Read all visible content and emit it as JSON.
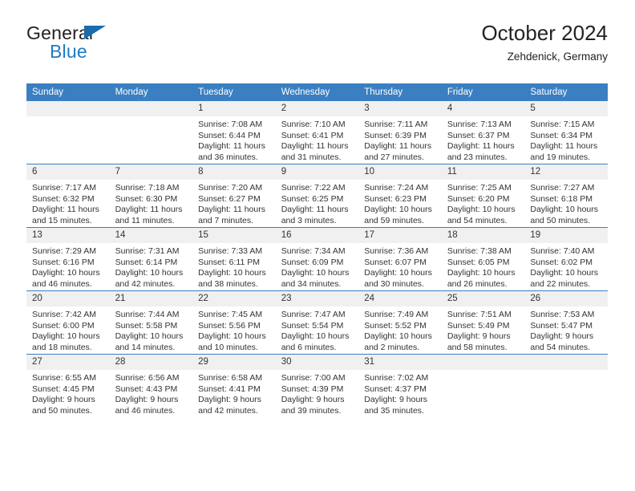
{
  "brand": {
    "name_top": "General",
    "name_bottom": "Blue",
    "triangle_color": "#1b6ca8",
    "blue_text_color": "#1f7ac0"
  },
  "header": {
    "title": "October 2024",
    "subtitle": "Zehdenick, Germany"
  },
  "theme": {
    "header_blue": "#3a7fc1",
    "daynum_band": "#f0f0f0",
    "text": "#333333"
  },
  "labels": {
    "sunrise_prefix": "Sunrise:",
    "sunset_prefix": "Sunset:",
    "daylight_prefix": "Daylight:"
  },
  "columns": [
    "Sunday",
    "Monday",
    "Tuesday",
    "Wednesday",
    "Thursday",
    "Friday",
    "Saturday"
  ],
  "weeks": [
    [
      {
        "day": "",
        "blank": true
      },
      {
        "day": "",
        "blank": true
      },
      {
        "day": "1",
        "sunrise": "Sunrise: 7:08 AM",
        "sunset": "Sunset: 6:44 PM",
        "daylight": "Daylight: 11 hours and 36 minutes."
      },
      {
        "day": "2",
        "sunrise": "Sunrise: 7:10 AM",
        "sunset": "Sunset: 6:41 PM",
        "daylight": "Daylight: 11 hours and 31 minutes."
      },
      {
        "day": "3",
        "sunrise": "Sunrise: 7:11 AM",
        "sunset": "Sunset: 6:39 PM",
        "daylight": "Daylight: 11 hours and 27 minutes."
      },
      {
        "day": "4",
        "sunrise": "Sunrise: 7:13 AM",
        "sunset": "Sunset: 6:37 PM",
        "daylight": "Daylight: 11 hours and 23 minutes."
      },
      {
        "day": "5",
        "sunrise": "Sunrise: 7:15 AM",
        "sunset": "Sunset: 6:34 PM",
        "daylight": "Daylight: 11 hours and 19 minutes."
      }
    ],
    [
      {
        "day": "6",
        "sunrise": "Sunrise: 7:17 AM",
        "sunset": "Sunset: 6:32 PM",
        "daylight": "Daylight: 11 hours and 15 minutes."
      },
      {
        "day": "7",
        "sunrise": "Sunrise: 7:18 AM",
        "sunset": "Sunset: 6:30 PM",
        "daylight": "Daylight: 11 hours and 11 minutes."
      },
      {
        "day": "8",
        "sunrise": "Sunrise: 7:20 AM",
        "sunset": "Sunset: 6:27 PM",
        "daylight": "Daylight: 11 hours and 7 minutes."
      },
      {
        "day": "9",
        "sunrise": "Sunrise: 7:22 AM",
        "sunset": "Sunset: 6:25 PM",
        "daylight": "Daylight: 11 hours and 3 minutes."
      },
      {
        "day": "10",
        "sunrise": "Sunrise: 7:24 AM",
        "sunset": "Sunset: 6:23 PM",
        "daylight": "Daylight: 10 hours and 59 minutes."
      },
      {
        "day": "11",
        "sunrise": "Sunrise: 7:25 AM",
        "sunset": "Sunset: 6:20 PM",
        "daylight": "Daylight: 10 hours and 54 minutes."
      },
      {
        "day": "12",
        "sunrise": "Sunrise: 7:27 AM",
        "sunset": "Sunset: 6:18 PM",
        "daylight": "Daylight: 10 hours and 50 minutes."
      }
    ],
    [
      {
        "day": "13",
        "sunrise": "Sunrise: 7:29 AM",
        "sunset": "Sunset: 6:16 PM",
        "daylight": "Daylight: 10 hours and 46 minutes."
      },
      {
        "day": "14",
        "sunrise": "Sunrise: 7:31 AM",
        "sunset": "Sunset: 6:14 PM",
        "daylight": "Daylight: 10 hours and 42 minutes."
      },
      {
        "day": "15",
        "sunrise": "Sunrise: 7:33 AM",
        "sunset": "Sunset: 6:11 PM",
        "daylight": "Daylight: 10 hours and 38 minutes."
      },
      {
        "day": "16",
        "sunrise": "Sunrise: 7:34 AM",
        "sunset": "Sunset: 6:09 PM",
        "daylight": "Daylight: 10 hours and 34 minutes."
      },
      {
        "day": "17",
        "sunrise": "Sunrise: 7:36 AM",
        "sunset": "Sunset: 6:07 PM",
        "daylight": "Daylight: 10 hours and 30 minutes."
      },
      {
        "day": "18",
        "sunrise": "Sunrise: 7:38 AM",
        "sunset": "Sunset: 6:05 PM",
        "daylight": "Daylight: 10 hours and 26 minutes."
      },
      {
        "day": "19",
        "sunrise": "Sunrise: 7:40 AM",
        "sunset": "Sunset: 6:02 PM",
        "daylight": "Daylight: 10 hours and 22 minutes."
      }
    ],
    [
      {
        "day": "20",
        "sunrise": "Sunrise: 7:42 AM",
        "sunset": "Sunset: 6:00 PM",
        "daylight": "Daylight: 10 hours and 18 minutes."
      },
      {
        "day": "21",
        "sunrise": "Sunrise: 7:44 AM",
        "sunset": "Sunset: 5:58 PM",
        "daylight": "Daylight: 10 hours and 14 minutes."
      },
      {
        "day": "22",
        "sunrise": "Sunrise: 7:45 AM",
        "sunset": "Sunset: 5:56 PM",
        "daylight": "Daylight: 10 hours and 10 minutes."
      },
      {
        "day": "23",
        "sunrise": "Sunrise: 7:47 AM",
        "sunset": "Sunset: 5:54 PM",
        "daylight": "Daylight: 10 hours and 6 minutes."
      },
      {
        "day": "24",
        "sunrise": "Sunrise: 7:49 AM",
        "sunset": "Sunset: 5:52 PM",
        "daylight": "Daylight: 10 hours and 2 minutes."
      },
      {
        "day": "25",
        "sunrise": "Sunrise: 7:51 AM",
        "sunset": "Sunset: 5:49 PM",
        "daylight": "Daylight: 9 hours and 58 minutes."
      },
      {
        "day": "26",
        "sunrise": "Sunrise: 7:53 AM",
        "sunset": "Sunset: 5:47 PM",
        "daylight": "Daylight: 9 hours and 54 minutes."
      }
    ],
    [
      {
        "day": "27",
        "sunrise": "Sunrise: 6:55 AM",
        "sunset": "Sunset: 4:45 PM",
        "daylight": "Daylight: 9 hours and 50 minutes."
      },
      {
        "day": "28",
        "sunrise": "Sunrise: 6:56 AM",
        "sunset": "Sunset: 4:43 PM",
        "daylight": "Daylight: 9 hours and 46 minutes."
      },
      {
        "day": "29",
        "sunrise": "Sunrise: 6:58 AM",
        "sunset": "Sunset: 4:41 PM",
        "daylight": "Daylight: 9 hours and 42 minutes."
      },
      {
        "day": "30",
        "sunrise": "Sunrise: 7:00 AM",
        "sunset": "Sunset: 4:39 PM",
        "daylight": "Daylight: 9 hours and 39 minutes."
      },
      {
        "day": "31",
        "sunrise": "Sunrise: 7:02 AM",
        "sunset": "Sunset: 4:37 PM",
        "daylight": "Daylight: 9 hours and 35 minutes."
      },
      {
        "day": "",
        "blank": true
      },
      {
        "day": "",
        "blank": true
      }
    ]
  ]
}
